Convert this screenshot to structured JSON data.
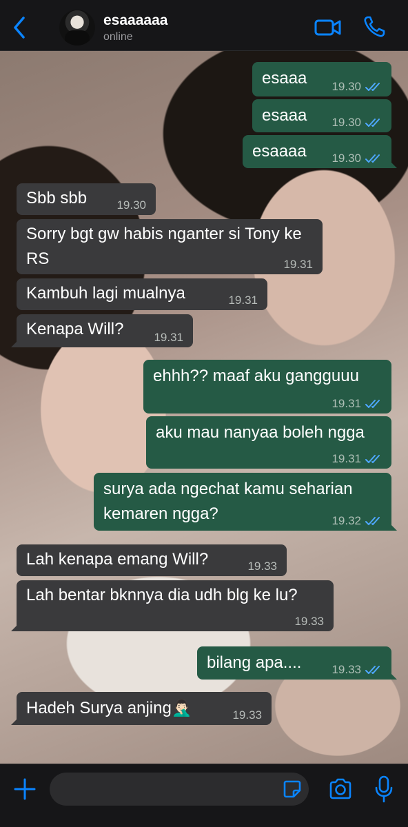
{
  "header": {
    "contact_name": "esaaaaaa",
    "status": "online",
    "icons": [
      "back-chevron-icon",
      "video-call-icon",
      "phone-call-icon"
    ]
  },
  "colors": {
    "accent": "#0a84ff",
    "incoming_bubble": "#3a3a3c",
    "outgoing_bubble": "#255a45",
    "read_ticks": "#4fa8ff"
  },
  "messages": [
    {
      "direction": "out",
      "text": "esaaa",
      "time": "19.30",
      "read": true
    },
    {
      "direction": "out",
      "text": "esaaa",
      "time": "19.30",
      "read": true
    },
    {
      "direction": "out",
      "text": "esaaaa",
      "time": "19.30",
      "read": true
    },
    {
      "direction": "in",
      "text": "Sbb sbb",
      "time": "19.30"
    },
    {
      "direction": "in",
      "text": "Sorry bgt gw habis nganter si Tony ke RS",
      "time": "19.31"
    },
    {
      "direction": "in",
      "text": "Kambuh lagi mualnya",
      "time": "19.31"
    },
    {
      "direction": "in",
      "text": "Kenapa Will?",
      "time": "19.31"
    },
    {
      "direction": "out",
      "text": "ehhh?? maaf aku gangguuu",
      "time": "19.31",
      "read": true
    },
    {
      "direction": "out",
      "text": "aku mau nanyaa boleh ngga",
      "time": "19.31",
      "read": true
    },
    {
      "direction": "out",
      "text": "surya ada ngechat kamu seharian kemaren ngga?",
      "time": "19.32",
      "read": true
    },
    {
      "direction": "in",
      "text": "Lah kenapa emang Will?",
      "time": "19.33"
    },
    {
      "direction": "in",
      "text": "Lah bentar bknnya dia udh blg ke lu?",
      "time": "19.33"
    },
    {
      "direction": "out",
      "text": "bilang apa....",
      "time": "19.33",
      "read": true
    },
    {
      "direction": "in",
      "text": "Hadeh Surya anjing🤦🏻‍♂️",
      "time": "19.33"
    }
  ],
  "composer": {
    "placeholder": "",
    "icons": [
      "plus-icon",
      "sticker-icon",
      "camera-icon",
      "microphone-icon"
    ]
  }
}
